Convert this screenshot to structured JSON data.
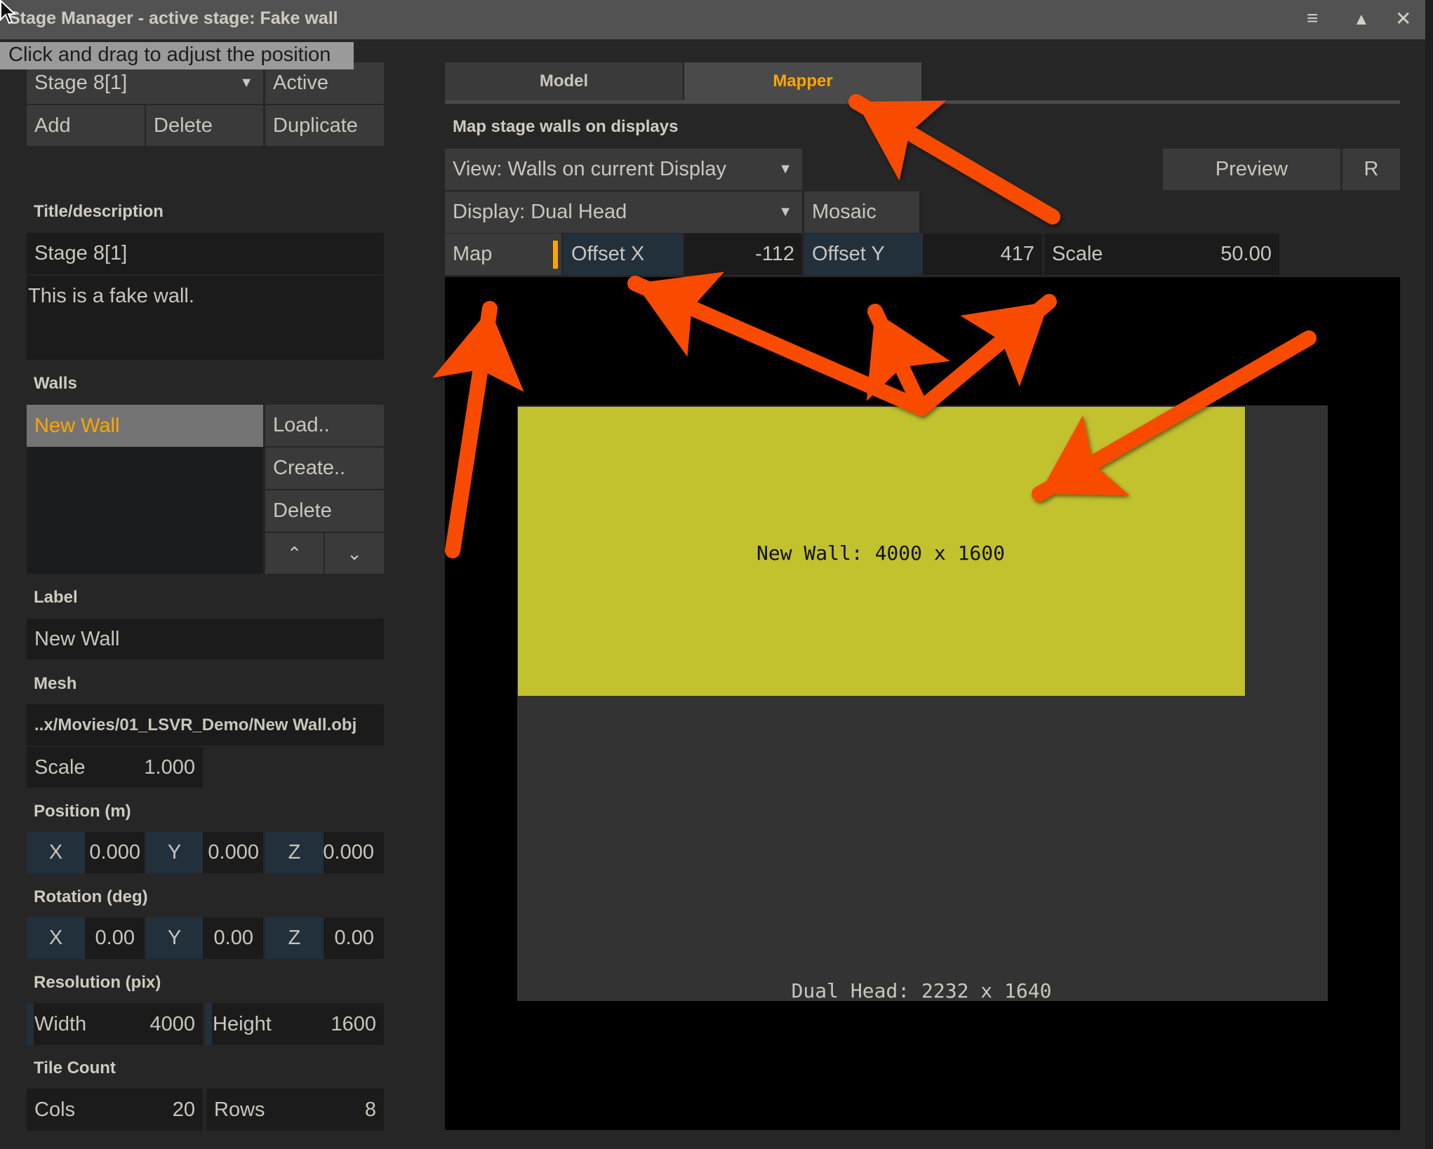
{
  "window": {
    "title": "Stage Manager - active stage: Fake wall",
    "icons": [
      "menu-icon",
      "maximize-icon",
      "close-icon"
    ]
  },
  "tooltip": "Click and drag to adjust the position",
  "stage": {
    "selected": "Stage 8[1]",
    "active_label": "Active",
    "add": "Add",
    "delete": "Delete",
    "duplicate": "Duplicate"
  },
  "title_section": {
    "label": "Title/description",
    "title": "Stage 8[1]",
    "description": "This is a fake wall."
  },
  "walls": {
    "label": "Walls",
    "items": [
      "New Wall"
    ],
    "load": "Load..",
    "create": "Create..",
    "delete": "Delete"
  },
  "label_section": {
    "label": "Label",
    "value": "New Wall"
  },
  "mesh": {
    "label": "Mesh",
    "path": "..x/Movies/01_LSVR_Demo/New Wall.obj",
    "scale_label": "Scale",
    "scale_value": "1.000"
  },
  "position": {
    "label": "Position (m)",
    "x_label": "X",
    "x": "0.000",
    "y_label": "Y",
    "y": "0.000",
    "z_label": "Z",
    "z": "0.000"
  },
  "rotation": {
    "label": "Rotation (deg)",
    "x_label": "X",
    "x": "0.00",
    "y_label": "Y",
    "y": "0.00",
    "z_label": "Z",
    "z": "0.00"
  },
  "resolution": {
    "label": "Resolution (pix)",
    "width_label": "Width",
    "width": "4000",
    "height_label": "Height",
    "height": "1600"
  },
  "tiles": {
    "label": "Tile Count",
    "cols_label": "Cols",
    "cols": "20",
    "rows_label": "Rows",
    "rows": "8"
  },
  "tabs": [
    {
      "label": "Model",
      "active": false
    },
    {
      "label": "Mapper",
      "active": true
    }
  ],
  "mapper": {
    "heading": "Map stage walls on displays",
    "view": "View: Walls on current Display",
    "preview": "Preview",
    "r": "R",
    "display": "Display: Dual Head",
    "mosaic": "Mosaic",
    "map": "Map",
    "offset_x_label": "Offset X",
    "offset_x": "-112",
    "offset_y_label": "Offset Y",
    "offset_y": "417",
    "scale_label": "Scale",
    "scale": "50.00",
    "wall_caption": "New Wall: 4000 x 1600",
    "display_caption": "Dual Head: 2232 x 1640"
  },
  "colors": {
    "accent": "#ffa500",
    "wall": "#c2c12e",
    "arrow": "#f84c00",
    "axis_bg": "#22303c"
  }
}
